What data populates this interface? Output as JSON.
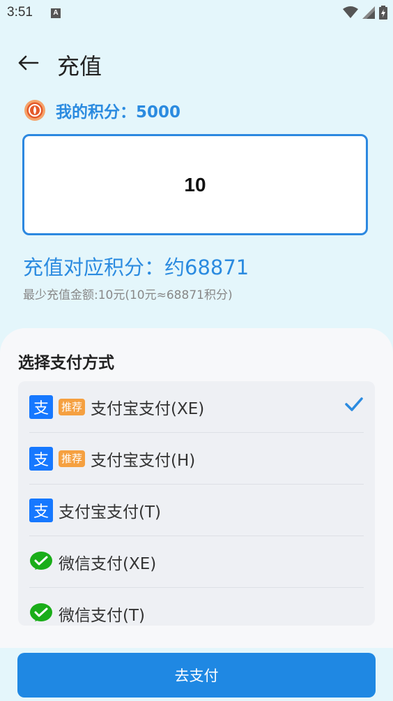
{
  "status_bar": {
    "time": "3:51",
    "notification_letter": "A"
  },
  "header": {
    "title": "充值"
  },
  "points": {
    "label": "我的积分：5000"
  },
  "amount": {
    "value": "10"
  },
  "conversion": {
    "text": "充值对应积分：约68871",
    "min_text": "最少充值金额:10元(10元≈68871积分)"
  },
  "payment": {
    "section_title": "选择支付方式",
    "methods": [
      {
        "label": "支付宝支付(XE)",
        "badge": "推荐",
        "icon": "alipay-icon",
        "selected": true
      },
      {
        "label": "支付宝支付(H)",
        "badge": "推荐",
        "icon": "alipay-icon",
        "selected": false
      },
      {
        "label": "支付宝支付(T)",
        "badge": "",
        "icon": "alipay-icon",
        "selected": false
      },
      {
        "label": "微信支付(XE)",
        "badge": "",
        "icon": "wechat-pay-icon",
        "selected": false
      },
      {
        "label": "微信支付(T)",
        "badge": "",
        "icon": "wechat-pay-icon",
        "selected": false
      }
    ]
  },
  "pay_button": {
    "label": "去支付"
  },
  "colors": {
    "accent": "#2b8be0",
    "badge": "#f5a040",
    "wechat": "#1aad19",
    "alipay": "#1678ff",
    "background": "#e4f6fb"
  }
}
